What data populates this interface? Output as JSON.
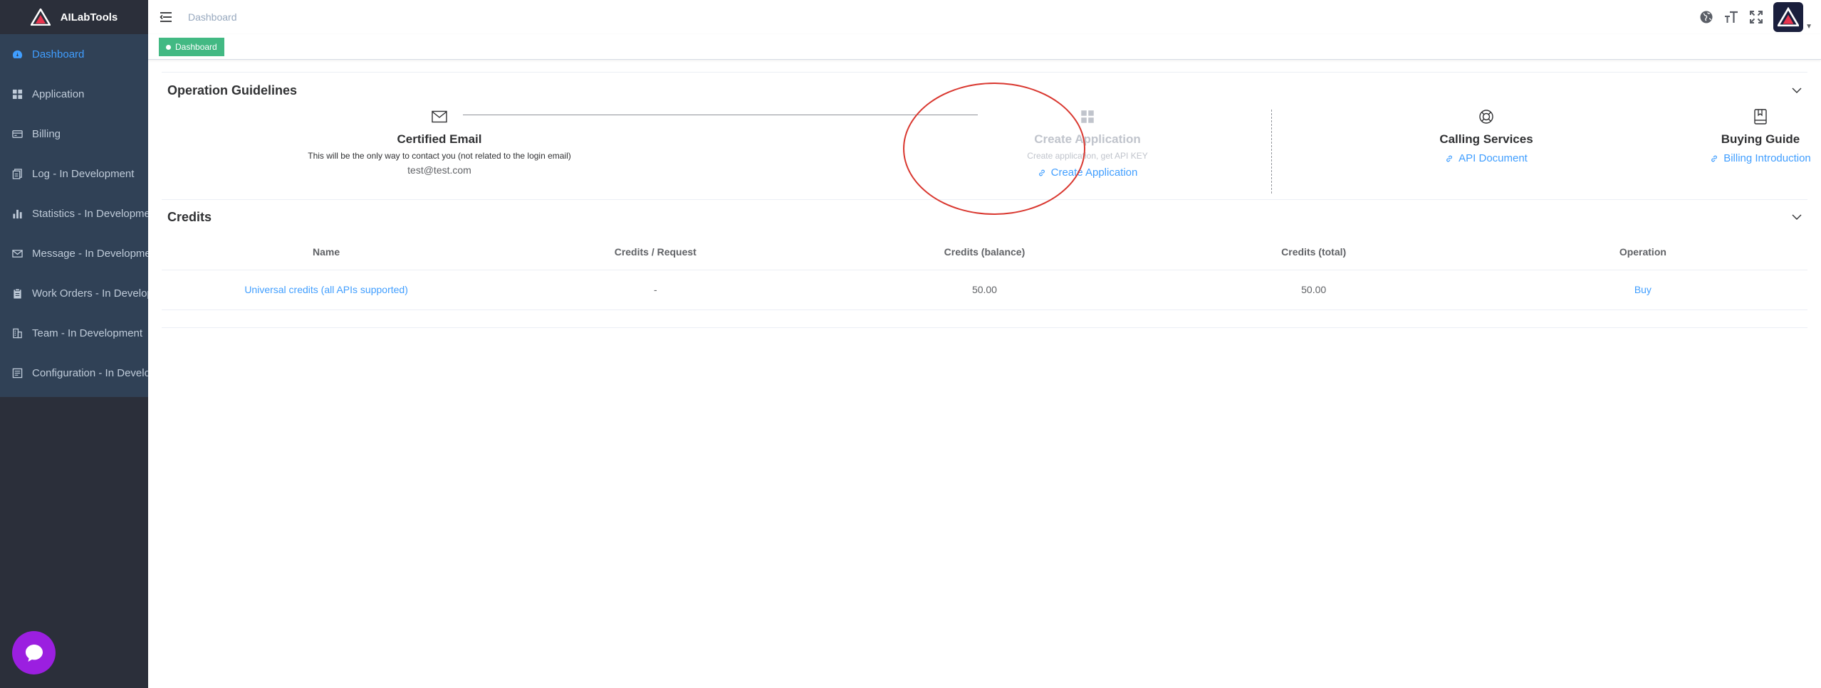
{
  "brand": {
    "name": "AILabTools"
  },
  "sidebar": {
    "items": [
      {
        "label": "Dashboard",
        "icon": "dashboard-icon",
        "active": true
      },
      {
        "label": "Application",
        "icon": "grid-icon"
      },
      {
        "label": "Billing",
        "icon": "card-icon"
      },
      {
        "label": "Log - In Development",
        "icon": "documents-icon"
      },
      {
        "label": "Statistics - In Development",
        "icon": "bar-chart-icon"
      },
      {
        "label": "Message - In Development",
        "icon": "mail-icon"
      },
      {
        "label": "Work Orders - In Development",
        "icon": "clipboard-icon"
      },
      {
        "label": "Team - In Development",
        "icon": "building-icon"
      },
      {
        "label": "Configuration - In Development",
        "icon": "config-icon"
      }
    ]
  },
  "header": {
    "breadcrumb": "Dashboard",
    "tools": [
      "globe-icon",
      "font-size-icon",
      "fullscreen-icon"
    ]
  },
  "tags": {
    "active": "Dashboard"
  },
  "guide": {
    "title": "Operation Guidelines",
    "steps": {
      "email": {
        "title": "Certified Email",
        "desc": "This will be the only way to contact you (not related to the login email)",
        "value": "test@test.com"
      },
      "app": {
        "title": "Create Application",
        "desc": "Create application, get API KEY",
        "link": "Create Application"
      },
      "calling": {
        "title": "Calling Services",
        "link": "API Document"
      },
      "buying": {
        "title": "Buying Guide",
        "link": "Billing Introduction"
      }
    }
  },
  "credits": {
    "title": "Credits",
    "columns": [
      "Name",
      "Credits / Request",
      "Credits (balance)",
      "Credits (total)",
      "Operation"
    ],
    "rows": [
      {
        "name": "Universal credits (all APIs supported)",
        "per_request": "-",
        "balance": "50.00",
        "total": "50.00",
        "operation": "Buy"
      }
    ]
  },
  "colors": {
    "sidebar_bg": "#304156",
    "accent": "#409eff",
    "tag_green": "#42b983",
    "annotation_red": "#d9372f",
    "chat_purple": "#9b1fe0"
  }
}
